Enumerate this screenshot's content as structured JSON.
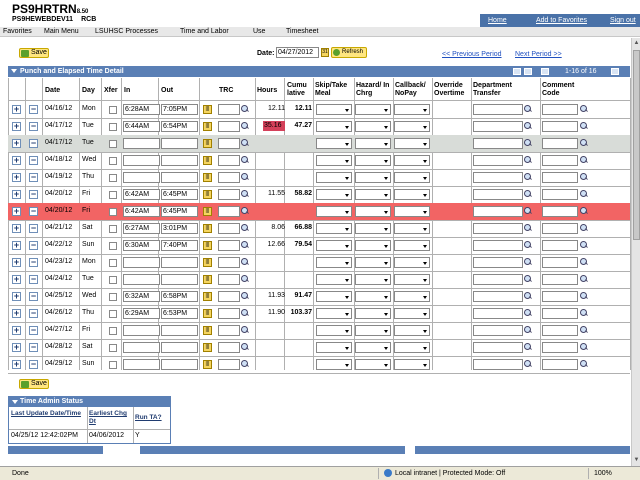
{
  "app": {
    "title": "PS9HRTRN",
    "version": "8.50",
    "server": "PS9HEWEBDEV11",
    "site": "RCB"
  },
  "header_links": [
    "Home",
    "Add to Favorites",
    "Sign out"
  ],
  "breadcrumb": [
    "Favorites",
    "Main Menu",
    "LSUHSC Processes",
    "Time and Labor",
    "Use",
    "Timesheet"
  ],
  "toolbar": {
    "save_label": "Save",
    "date_label": "Date:",
    "date_value": "04/27/2012",
    "refresh_label": "Refresh",
    "prev_period": "<< Previous Period",
    "next_period": "Next Period >>"
  },
  "grid": {
    "title": "Punch and Elapsed Time Detail",
    "range": "1-16 of 16",
    "columns": {
      "date": "Date",
      "day": "Day",
      "xfer": "Xfer",
      "in": "In",
      "out": "Out",
      "trc": "TRC",
      "hours": "Hours",
      "cumulative": "Cumu lative",
      "skip_meal": "Skip/Take Meal",
      "hazard": "Hazard/ In Chrg",
      "callback": "Callback/ NoPay",
      "override": "Override Overtime",
      "dept": "Department Transfer",
      "comment": "Comment Code"
    },
    "rows": [
      {
        "date": "04/16/12",
        "day": "Mon",
        "in": "6:28AM",
        "out": "7:05PM",
        "hours": "12.11",
        "cum": "12.11",
        "state": "normal"
      },
      {
        "date": "04/17/12",
        "day": "Tue",
        "in": "6:44AM",
        "out": "6:54PM",
        "hours": "35.16",
        "cum": "47.27",
        "state": "hourserr"
      },
      {
        "date": "04/17/12",
        "day": "Tue",
        "in": "",
        "out": "",
        "hours": "",
        "cum": "",
        "state": "gray"
      },
      {
        "date": "04/18/12",
        "day": "Wed",
        "in": "",
        "out": "",
        "hours": "",
        "cum": "",
        "state": "normal"
      },
      {
        "date": "04/19/12",
        "day": "Thu",
        "in": "",
        "out": "",
        "hours": "",
        "cum": "",
        "state": "normal"
      },
      {
        "date": "04/20/12",
        "day": "Fri",
        "in": "6:42AM",
        "out": "6:45PM",
        "hours": "11.55",
        "cum": "58.82",
        "state": "normal"
      },
      {
        "date": "04/20/12",
        "day": "Fri",
        "in": "6:42AM",
        "out": "6:45PM",
        "hours": "",
        "cum": "",
        "state": "red"
      },
      {
        "date": "04/21/12",
        "day": "Sat",
        "in": "6:27AM",
        "out": "3:01PM",
        "hours": "8.06",
        "cum": "66.88",
        "state": "normal"
      },
      {
        "date": "04/22/12",
        "day": "Sun",
        "in": "6:30AM",
        "out": "7:40PM",
        "hours": "12.66",
        "cum": "79.54",
        "state": "normal"
      },
      {
        "date": "04/23/12",
        "day": "Mon",
        "in": "",
        "out": "",
        "hours": "",
        "cum": "",
        "state": "normal"
      },
      {
        "date": "04/24/12",
        "day": "Tue",
        "in": "",
        "out": "",
        "hours": "",
        "cum": "",
        "state": "normal"
      },
      {
        "date": "04/25/12",
        "day": "Wed",
        "in": "6:32AM",
        "out": "6:58PM",
        "hours": "11.93",
        "cum": "91.47",
        "state": "normal"
      },
      {
        "date": "04/26/12",
        "day": "Thu",
        "in": "6:29AM",
        "out": "6:53PM",
        "hours": "11.90",
        "cum": "103.37",
        "state": "normal"
      },
      {
        "date": "04/27/12",
        "day": "Fri",
        "in": "",
        "out": "",
        "hours": "",
        "cum": "",
        "state": "normal"
      },
      {
        "date": "04/28/12",
        "day": "Sat",
        "in": "",
        "out": "",
        "hours": "",
        "cum": "",
        "state": "normal"
      },
      {
        "date": "04/29/12",
        "day": "Sun",
        "in": "",
        "out": "",
        "hours": "",
        "cum": "",
        "state": "normal"
      }
    ]
  },
  "time_admin": {
    "title": "Time Admin Status",
    "col1": "Last Update Date/Time",
    "col2": "Earliest Chg Dt",
    "col3": "Run TA?",
    "val1": "04/25/12 12:42:02PM",
    "val2": "04/06/2012",
    "val3": "Y"
  },
  "status_bar": {
    "left": "Done",
    "zone": "Local intranet | Protected Mode: Off",
    "zoom": "100%"
  },
  "colors": {
    "header_blue": "#5a7fb5",
    "error_red": "#f26464",
    "hours_error": "#d4405a"
  }
}
